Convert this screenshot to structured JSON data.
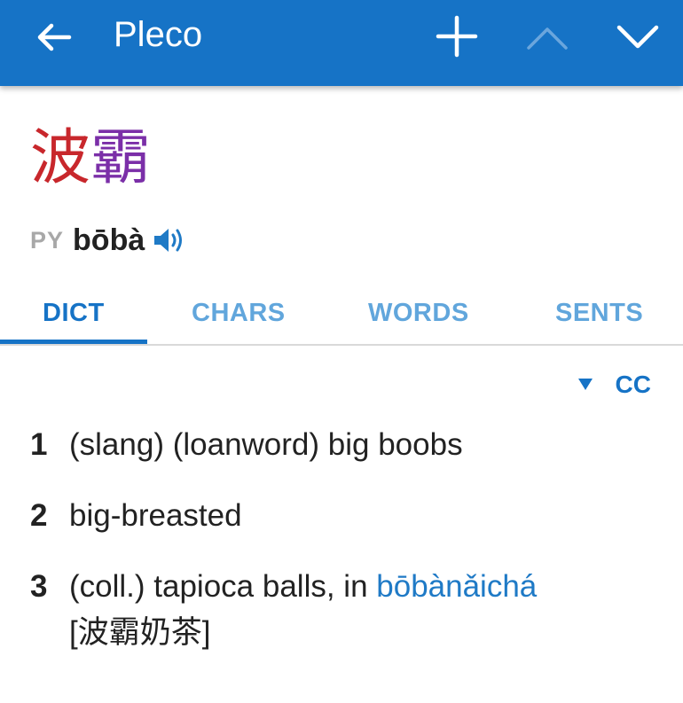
{
  "appbar": {
    "title": "Pleco",
    "back_icon": "arrow-left-icon",
    "add_icon": "plus-icon",
    "prev_icon": "chevron-up-icon",
    "next_icon": "chevron-down-icon",
    "background_color": "#1673c6"
  },
  "entry": {
    "headword_char1": "波",
    "headword_char2": "霸",
    "char1_color": "#c8272c",
    "char2_color": "#7b2fa8",
    "pinyin_label": "PY",
    "pinyin": "bōbà",
    "audio_icon": "speaker-icon"
  },
  "tabs": [
    {
      "label": "DICT",
      "active": true
    },
    {
      "label": "CHARS",
      "active": false
    },
    {
      "label": "WORDS",
      "active": false
    },
    {
      "label": "SENTS",
      "active": false
    }
  ],
  "source": {
    "dropdown_icon": "triangle-down-icon",
    "label": "CC"
  },
  "definitions": [
    {
      "num": "1",
      "text": "(slang) (loanword) big boobs"
    },
    {
      "num": "2",
      "text": "big-breasted"
    },
    {
      "num": "3",
      "text_before": "(coll.) tapioca balls, in ",
      "link": "bōbànǎichá",
      "text_after": "[波霸奶茶]"
    }
  ]
}
